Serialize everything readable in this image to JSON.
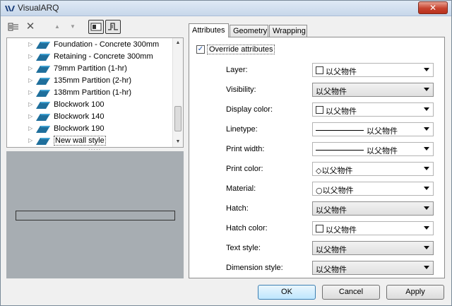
{
  "window": {
    "title": "VisualARQ",
    "close_label": "✕"
  },
  "toolbar": {
    "icons": [
      "style-manager-icon",
      "delete-icon",
      "move-up-icon",
      "move-down-icon",
      "plan-view-icon",
      "section-view-icon"
    ]
  },
  "tree": {
    "items": [
      {
        "label": "Foundation - Concrete 300mm"
      },
      {
        "label": "Retaining - Concrete 300mm"
      },
      {
        "label": "79mm Partition (1-hr)"
      },
      {
        "label": "135mm Partition (2-hr)"
      },
      {
        "label": "138mm Partition (1-hr)"
      },
      {
        "label": "Blockwork 100"
      },
      {
        "label": "Blockwork 140"
      },
      {
        "label": "Blockwork 190"
      },
      {
        "label": "New wall style",
        "selected": true
      }
    ]
  },
  "tabs": [
    "Attributes",
    "Geometry",
    "Wrapping"
  ],
  "attributes": {
    "override_label": "Override attributes",
    "override_checked": true,
    "rows": [
      {
        "label": "Layer:",
        "value": "以父物件",
        "kind": "swatch"
      },
      {
        "label": "Visibility:",
        "value": "以父物件",
        "kind": "filled"
      },
      {
        "label": "Display color:",
        "value": "以父物件",
        "kind": "swatch"
      },
      {
        "label": "Linetype:",
        "value": "以父物件",
        "kind": "line"
      },
      {
        "label": "Print width:",
        "value": "以父物件",
        "kind": "line"
      },
      {
        "label": "Print color:",
        "value": "◇以父物件",
        "kind": "plain"
      },
      {
        "label": "Material:",
        "value": "○以父物件",
        "kind": "plain"
      },
      {
        "label": "Hatch:",
        "value": "以父物件",
        "kind": "filled"
      },
      {
        "label": "Hatch color:",
        "value": "以父物件",
        "kind": "swatch"
      },
      {
        "label": "Text style:",
        "value": "以父物件",
        "kind": "filled"
      },
      {
        "label": "Dimension style:",
        "value": "以父物件",
        "kind": "filled"
      }
    ]
  },
  "buttons": {
    "ok": "OK",
    "cancel": "Cancel",
    "apply": "Apply"
  }
}
